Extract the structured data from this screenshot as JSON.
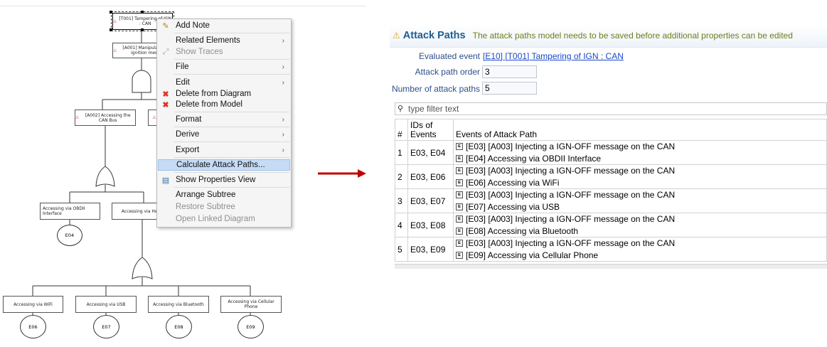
{
  "diagram": {
    "top_node": "[T001] Tampering of IGN : CAN",
    "node_a001": "[A001] Manipulat the ignition mess",
    "node_a002": "[A002] Accessing the CAN Bus",
    "node_obd": "Accessing via OBDII Interface",
    "node_head": "Accessing via Head",
    "node_wifi": "Accessing via WiFi",
    "node_usb": "Accessing via USB",
    "node_bt": "Accessing via Bluetooth",
    "node_cell": "Accessing via Cellular Phone",
    "e04": "E04",
    "e06": "E06",
    "e07": "E07",
    "e08": "E08",
    "e09": "E09"
  },
  "context_menu": {
    "items": [
      {
        "label": "Add Note",
        "icon": "add-note-icon",
        "enabled": true
      },
      {
        "label": "Related Elements",
        "submenu": true,
        "enabled": true
      },
      {
        "label": "Show Traces",
        "icon": "show-traces-icon",
        "enabled": false
      },
      {
        "label": "File",
        "submenu": true,
        "enabled": true
      },
      {
        "label": "Edit",
        "submenu": true,
        "enabled": true
      },
      {
        "label": "Delete from Diagram",
        "icon": "red-x-icon",
        "enabled": true
      },
      {
        "label": "Delete from Model",
        "icon": "red-x-icon",
        "enabled": true
      },
      {
        "label": "Format",
        "submenu": true,
        "enabled": true
      },
      {
        "label": "Derive",
        "submenu": true,
        "enabled": true
      },
      {
        "label": "Export",
        "submenu": true,
        "enabled": true
      },
      {
        "label": "Calculate Attack Paths...",
        "enabled": true,
        "highlighted": true
      },
      {
        "label": "Show Properties View",
        "icon": "properties-view-icon",
        "enabled": true
      },
      {
        "label": "Arrange Subtree",
        "enabled": true
      },
      {
        "label": "Restore Subtree",
        "enabled": false
      },
      {
        "label": "Open Linked Diagram",
        "enabled": false
      }
    ],
    "submenu_arrow": "›"
  },
  "panel": {
    "title": "Attack Paths",
    "message": "The attack paths model needs to be saved before additional properties can be edited",
    "evaluated_event_label": "Evaluated event",
    "evaluated_event_value": "[E10] [T001] Tampering of IGN : CAN",
    "order_label": "Attack path order",
    "order_value": "3",
    "count_label": "Number of attack paths",
    "count_value": "5",
    "filter_placeholder": "type filter text",
    "columns": [
      "#",
      "IDs of Events",
      "Events of Attack Path"
    ],
    "rows": [
      {
        "num": "1",
        "ids": "E03, E04",
        "events": [
          "[E03] [A003] Injecting a IGN-OFF message on the CAN",
          "[E04] Accessing via OBDII Interface"
        ]
      },
      {
        "num": "2",
        "ids": "E03, E06",
        "events": [
          "[E03] [A003] Injecting a IGN-OFF message on the CAN",
          "[E06] Accessing via WiFi"
        ]
      },
      {
        "num": "3",
        "ids": "E03, E07",
        "events": [
          "[E03] [A003] Injecting a IGN-OFF message on the CAN",
          "[E07] Accessing via USB"
        ]
      },
      {
        "num": "4",
        "ids": "E03, E08",
        "events": [
          "[E03] [A003] Injecting a IGN-OFF message on the CAN",
          "[E08] Accessing via Bluetooth"
        ]
      },
      {
        "num": "5",
        "ids": "E03, E09",
        "events": [
          "[E03] [A003] Injecting a IGN-OFF message on the CAN",
          "[E09] Accessing via Cellular Phone"
        ]
      }
    ],
    "event_icon_letter": "E"
  },
  "colors": {
    "arrow": "#c00000",
    "title_blue": "#1d5f91",
    "message_green": "#6d7f1a",
    "link_blue": "#1a48c8",
    "menu_highlight": "#c6dcf5"
  }
}
